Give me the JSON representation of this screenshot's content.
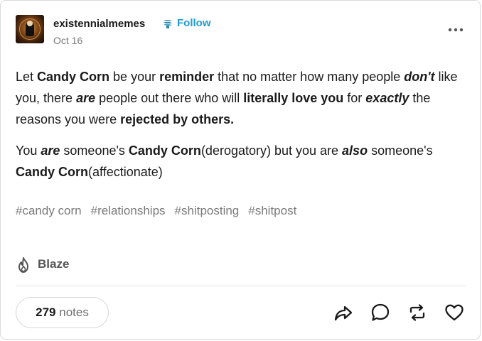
{
  "post": {
    "blog_name": "existennialmemes",
    "follow_label": "Follow",
    "date": "Oct 16",
    "paragraph1": [
      {
        "t": "Let ",
        "s": ""
      },
      {
        "t": "Candy Corn",
        "s": "b"
      },
      {
        "t": " be your ",
        "s": ""
      },
      {
        "t": "reminder",
        "s": "b"
      },
      {
        "t": " that no matter how many people ",
        "s": ""
      },
      {
        "t": "don't",
        "s": "bi"
      },
      {
        "t": " like you, there ",
        "s": ""
      },
      {
        "t": "are",
        "s": "bi"
      },
      {
        "t": " people out there who will ",
        "s": ""
      },
      {
        "t": "literally love you",
        "s": "b"
      },
      {
        "t": " for ",
        "s": ""
      },
      {
        "t": "exactly",
        "s": "bi"
      },
      {
        "t": " the reasons you were ",
        "s": ""
      },
      {
        "t": "rejected by others.",
        "s": "b"
      }
    ],
    "paragraph2": [
      {
        "t": "You ",
        "s": ""
      },
      {
        "t": "are",
        "s": "bi"
      },
      {
        "t": " someone's ",
        "s": ""
      },
      {
        "t": "Candy Corn",
        "s": "b"
      },
      {
        "t": "(derogatory) but you are ",
        "s": ""
      },
      {
        "t": "also",
        "s": "bi"
      },
      {
        "t": " someone's ",
        "s": ""
      },
      {
        "t": "Candy Corn",
        "s": "b"
      },
      {
        "t": "(affectionate)",
        "s": ""
      }
    ],
    "tags": [
      "#candy corn",
      "#relationships",
      "#shitposting",
      "#shitpost"
    ],
    "blaze_label": "Blaze",
    "notes_count": "279",
    "notes_label": "notes"
  },
  "icons": {
    "verified": "verified-badge-icon",
    "more": "more-options-icon",
    "blaze": "flame-icon",
    "share": "share-arrow-icon",
    "reply": "speech-bubble-icon",
    "reblog": "reblog-icon",
    "like": "heart-icon"
  },
  "colors": {
    "follow": "#1d9bd1",
    "muted": "#7a7a7a",
    "text": "#1a1a1a"
  }
}
